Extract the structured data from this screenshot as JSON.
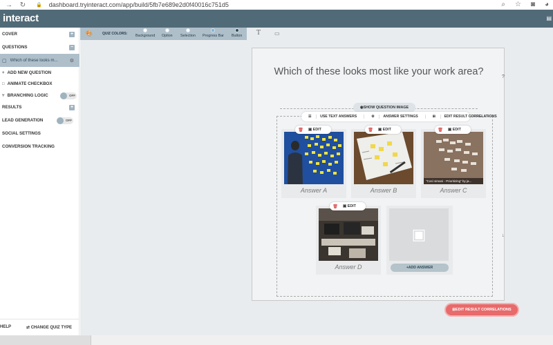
{
  "browser": {
    "back": "→",
    "reload": "↻",
    "url": "dashboard.tryinteract.com/app/build/5fb7e689e2d0f40016c751d5",
    "right_icons": [
      "zoom-icon",
      "star-icon",
      "camera-icon",
      "chrome-icon"
    ]
  },
  "app": {
    "logo": "interact",
    "window_icon": "▤"
  },
  "sidebar": {
    "cover": "COVER",
    "questions": "QUESTIONS",
    "question_item": "Which of these looks m...",
    "add_new_question": "ADD NEW QUESTION",
    "animate_checkbox": "ANIMATE CHECKBOX",
    "branching_logic": "BRANCHING LOGIC",
    "branching_toggle": "OFF",
    "results": "RESULTS",
    "lead_generation": "LEAD GENERATION",
    "lead_toggle": "OFF",
    "social_settings": "SOCIAL SETTINGS",
    "conversion_tracking": "CONVERSION TRACKING",
    "help": "HELP",
    "change_quiz_type": "CHANGE QUIZ TYPE"
  },
  "toolbar": {
    "quiz_colors_label": "QUIZ COLORS:",
    "swatches": [
      {
        "label": "Background",
        "color": "#ffffff"
      },
      {
        "label": "Option",
        "color": "#ffffff"
      },
      {
        "label": "Selection",
        "color": "#ffffff"
      },
      {
        "label": "Progress Bar",
        "color": "#7fb2d6"
      },
      {
        "label": "Button",
        "color": "#2d4a58"
      }
    ]
  },
  "question": {
    "title": "Which of these looks most like your work area?",
    "side_mark_top": "?",
    "side_mark_bottom": "↓",
    "show_image": "SHOW QUESTION IMAGE",
    "tools": [
      "USE TEXT ANSWERS",
      "ANSWER SETTINGS",
      "EDIT RESULT CORRELATIONS"
    ],
    "answers": [
      {
        "label": "Answer A",
        "edit": "EDIT"
      },
      {
        "label": "Answer B",
        "edit": "EDIT"
      },
      {
        "label": "Answer C",
        "edit": "EDIT",
        "overlay": "\"Così simani - Prioritizing\" by ja..."
      },
      {
        "label": "Answer D",
        "edit": "EDIT"
      }
    ],
    "add_answer": "ADD ANSWER"
  },
  "edit_result_correlations": "EDIT RESULT CORRELATIONS"
}
